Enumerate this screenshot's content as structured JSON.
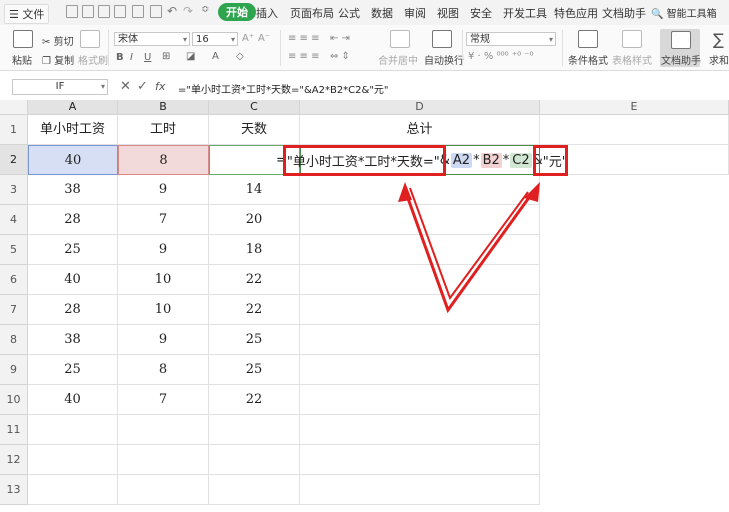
{
  "menubar": {
    "file_label": "文件",
    "tabs": [
      "开始",
      "插入",
      "页面布局",
      "公式",
      "数据",
      "审阅",
      "视图",
      "安全",
      "开发工具",
      "特色应用",
      "文档助手"
    ],
    "active_tab": "开始",
    "search_label": "智能工具箱"
  },
  "ribbon": {
    "paste": "粘贴",
    "cut": "剪切",
    "copy": "复制",
    "format_painter": "格式刷",
    "font_name": "宋体",
    "font_size": "16",
    "merge_center": "合并居中",
    "auto_wrap": "自动换行",
    "number_format": "常规",
    "cond_format": "条件格式",
    "table_style": "表格样式",
    "doc_helper": "文档助手",
    "sum": "求和"
  },
  "formula_bar": {
    "name_box": "IF",
    "fx": "fx",
    "formula": "=\"单小时工资*工时*天数=\"&A2*B2*C2&\"元\""
  },
  "grid": {
    "columns": [
      "A",
      "B",
      "C",
      "D",
      "E"
    ],
    "rows": [
      "1",
      "2",
      "3",
      "4",
      "5",
      "6",
      "7",
      "8",
      "9",
      "10",
      "11",
      "12",
      "13"
    ],
    "headers": [
      "单小时工资",
      "工时",
      "天数",
      "总计"
    ],
    "data": [
      [
        "40",
        "8",
        ""
      ],
      [
        "38",
        "9",
        "14"
      ],
      [
        "28",
        "7",
        "20"
      ],
      [
        "25",
        "9",
        "18"
      ],
      [
        "40",
        "10",
        "22"
      ],
      [
        "28",
        "10",
        "22"
      ],
      [
        "38",
        "9",
        "25"
      ],
      [
        "25",
        "8",
        "25"
      ],
      [
        "40",
        "7",
        "22"
      ]
    ]
  },
  "edit_formula": {
    "eq": "=",
    "text_part": "\"单小时工资*工时*天数=\"",
    "amp1": "&",
    "a2": "A2",
    "star1": "*",
    "b2": "B2",
    "star2": "*",
    "c2": "C2",
    "amp2": "&",
    "unit_part": "\"元\""
  },
  "annotation_color": "#e02020"
}
